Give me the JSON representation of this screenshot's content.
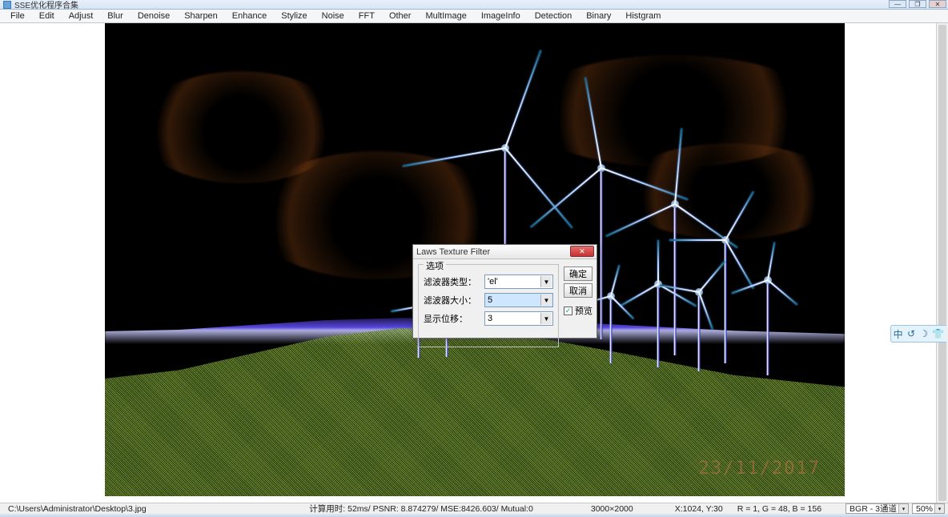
{
  "window": {
    "title": "SSE优化程序合集"
  },
  "menu": {
    "items": [
      "File",
      "Edit",
      "Adjust",
      "Blur",
      "Denoise",
      "Sharpen",
      "Enhance",
      "Stylize",
      "Noise",
      "FFT",
      "Other",
      "MultImage",
      "ImageInfo",
      "Detection",
      "Binary",
      "Histgram"
    ]
  },
  "dialog": {
    "title": "Laws Texture Filter",
    "group_label": "选项",
    "row1_label": "滤波器类型：",
    "row1_value": "'el'",
    "row2_label": "滤波器大小：",
    "row2_value": "5",
    "row3_label": "显示位移：",
    "row3_value": "3",
    "ok": "确定",
    "cancel": "取消",
    "preview": "预览",
    "preview_checked": true
  },
  "status": {
    "path": "C:\\Users\\Administrator\\Desktop\\3.jpg",
    "timing": "计算用时: 52ms/",
    "psnr": "PSNR: 8.874279/",
    "mse": "MSE:8426.603/",
    "mutual": "Mutual:0",
    "dims": "3000×2000",
    "cursor": "X:1024, Y:30",
    "pixel": "R = 1, G = 48, B = 156",
    "mode": "BGR - 3通道",
    "zoom": "50%"
  },
  "side_toolbar": {
    "i1": "中",
    "i2": "↺",
    "i3": "☽",
    "i4": "👕"
  },
  "watermark": "23/11/2017"
}
